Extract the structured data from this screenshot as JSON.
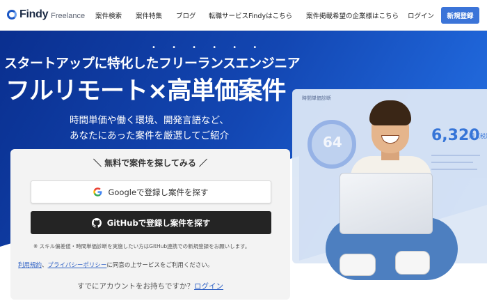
{
  "header": {
    "logo_text": "Findy",
    "logo_sub": "Freelance",
    "nav": [
      "案件検索",
      "案件特集",
      "ブログ",
      "転職サービスFindyはこちら",
      "案件掲載希望の企業様はこちら",
      "ログイン"
    ],
    "signup": "新規登録"
  },
  "hero": {
    "dots": "• • • • • •",
    "tagline": "スタートアップに特化したフリーランスエンジニア",
    "headline": "フルリモート×高単価案件",
    "sub1": "時間単価や働く環境、開発言語など、",
    "sub2": "あなたにあった案件を厳選してご紹介"
  },
  "dashboard": {
    "title": "時間単価診断",
    "gauge_value": "64",
    "amount": "6,320",
    "unit": "円（税別）"
  },
  "card": {
    "title": "＼ 無料で案件を探してみる ／",
    "google_label": "Googleで登録し案件を探す",
    "github_label": "GitHubで登録し案件を探す",
    "note": "※ スキル偏差値・時間単価診断を実施したい方はGitHub連携での新規登録をお願いします。",
    "terms_link": "利用規約",
    "terms_sep": "、",
    "privacy_link": "プライバシーポリシー",
    "terms_suffix": "に同意の上サービスをご利用ください。",
    "login_prompt": "すでにアカウントをお持ちですか？",
    "login_link": "ログイン"
  },
  "colors": {
    "brand": "#3b74d8",
    "hero_blue": "#1347b3",
    "github_btn": "#242424"
  }
}
